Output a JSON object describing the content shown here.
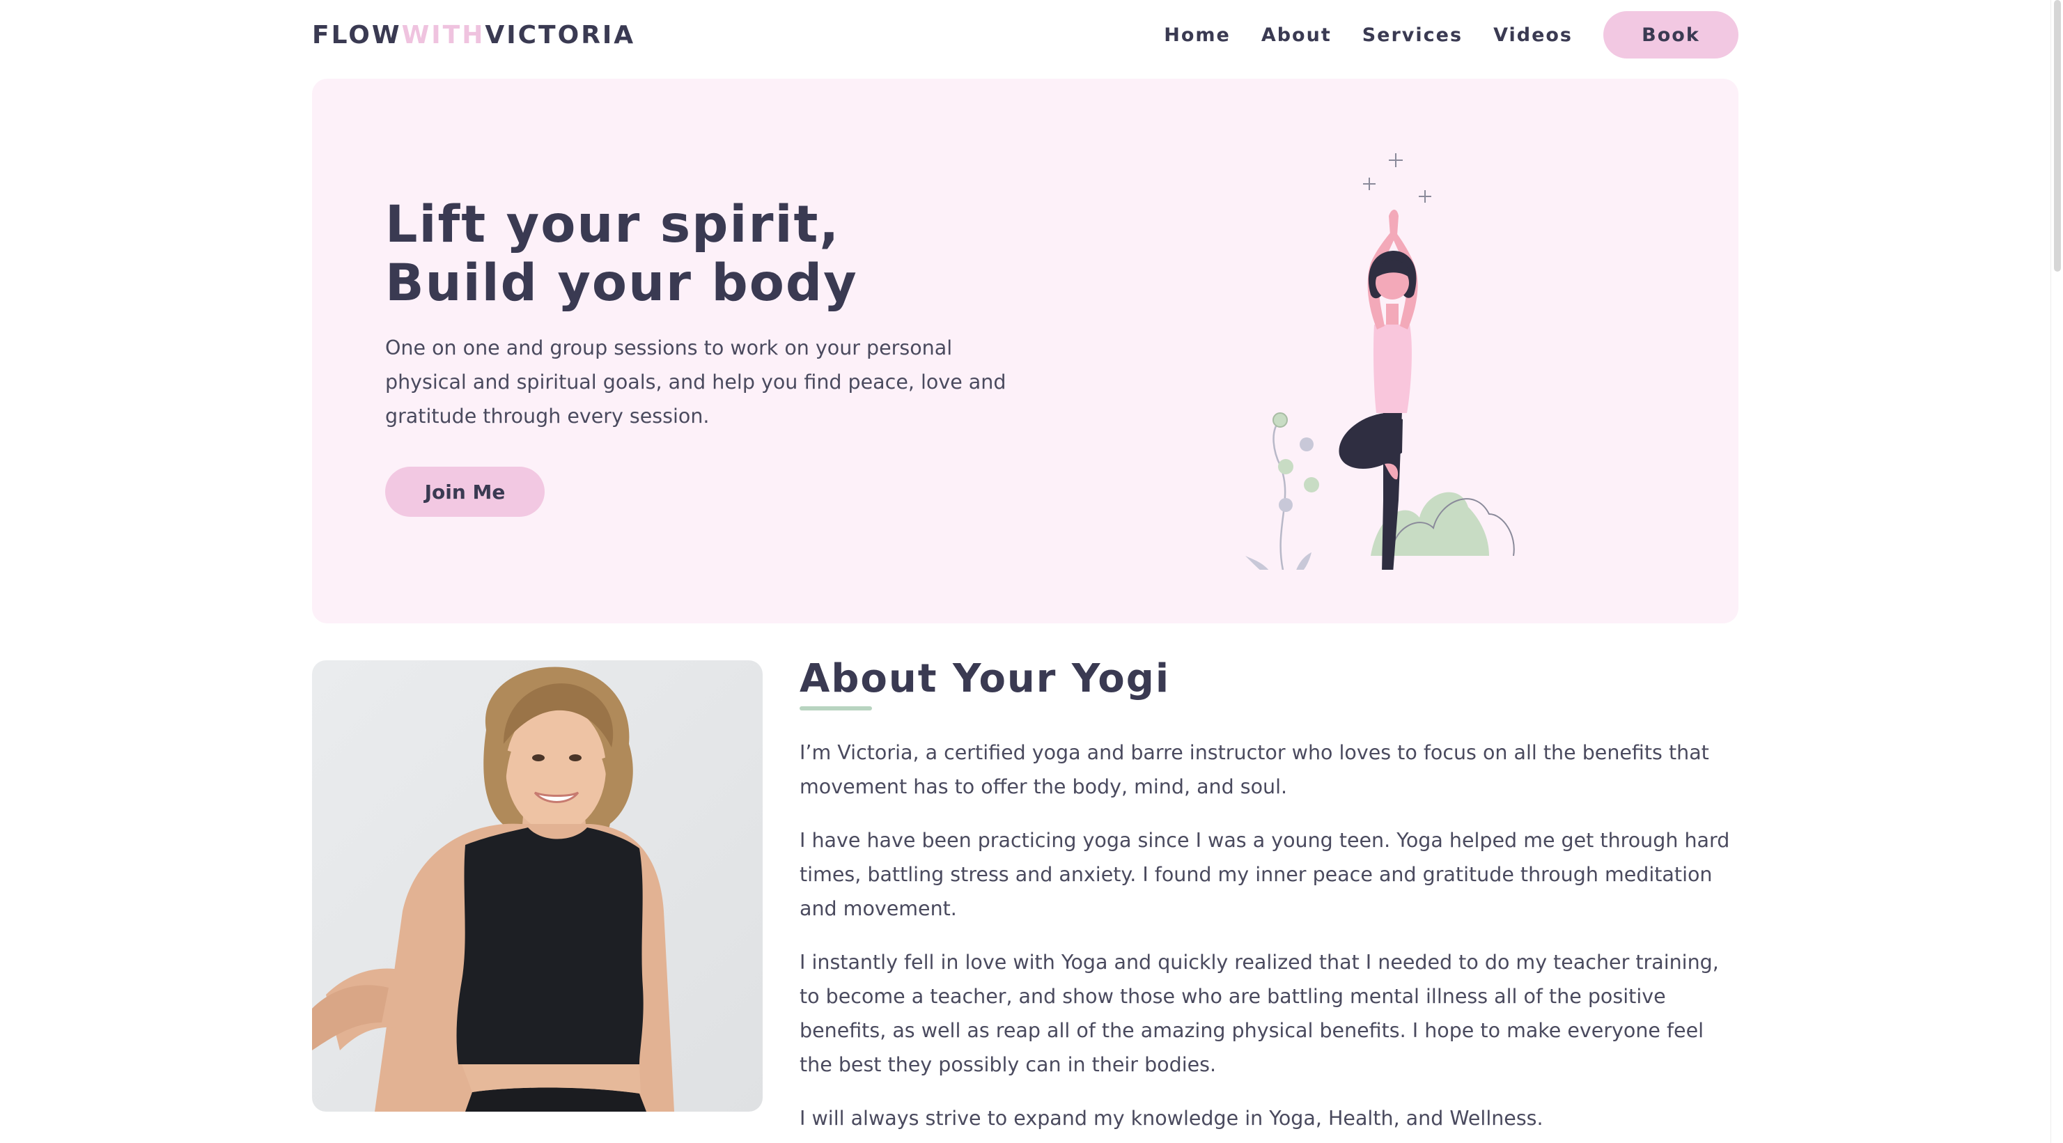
{
  "brand": {
    "logo_part1": "FLOW",
    "logo_part2": "WITH",
    "logo_part3": "VICTORIA",
    "accent_color": "#efc3df",
    "text_color": "#3a3a52",
    "hero_bg": "#fdf1f9",
    "button_color": "#f2c8e2",
    "underline_color": "#b8d4c0"
  },
  "nav": {
    "items": [
      {
        "label": "Home"
      },
      {
        "label": "About"
      },
      {
        "label": "Services"
      },
      {
        "label": "Videos"
      }
    ],
    "book_label": "Book"
  },
  "hero": {
    "title_line1": "Lift your spirit,",
    "title_line2": "Build your body",
    "text": "One on one and group sessions to work on your personal physical and spiritual goals, and help you find peace, love and gratitude through every session.",
    "cta_label": "Join Me",
    "illustration_icon": "yoga-tree-pose-illustration"
  },
  "about": {
    "title": "About Your Yogi",
    "photo_icon": "instructor-portrait-photo",
    "paragraphs": [
      "I’m Victoria, a certified yoga and barre instructor who loves to focus on all the benefits that movement has to offer the body, mind, and soul.",
      "I have have been practicing yoga since I was a young teen. Yoga helped me get through hard times, battling stress and anxiety. I found my inner peace and gratitude through meditation and movement.",
      "I instantly fell in love with Yoga and quickly realized that I needed to do my teacher training, to become a teacher, and show those who are battling mental illness all of the positive benefits, as well as reap all of the amazing physical benefits. I hope to make everyone feel the best they possibly can in their bodies.",
      "I will always strive to expand my knowledge in Yoga, Health, and Wellness."
    ]
  }
}
